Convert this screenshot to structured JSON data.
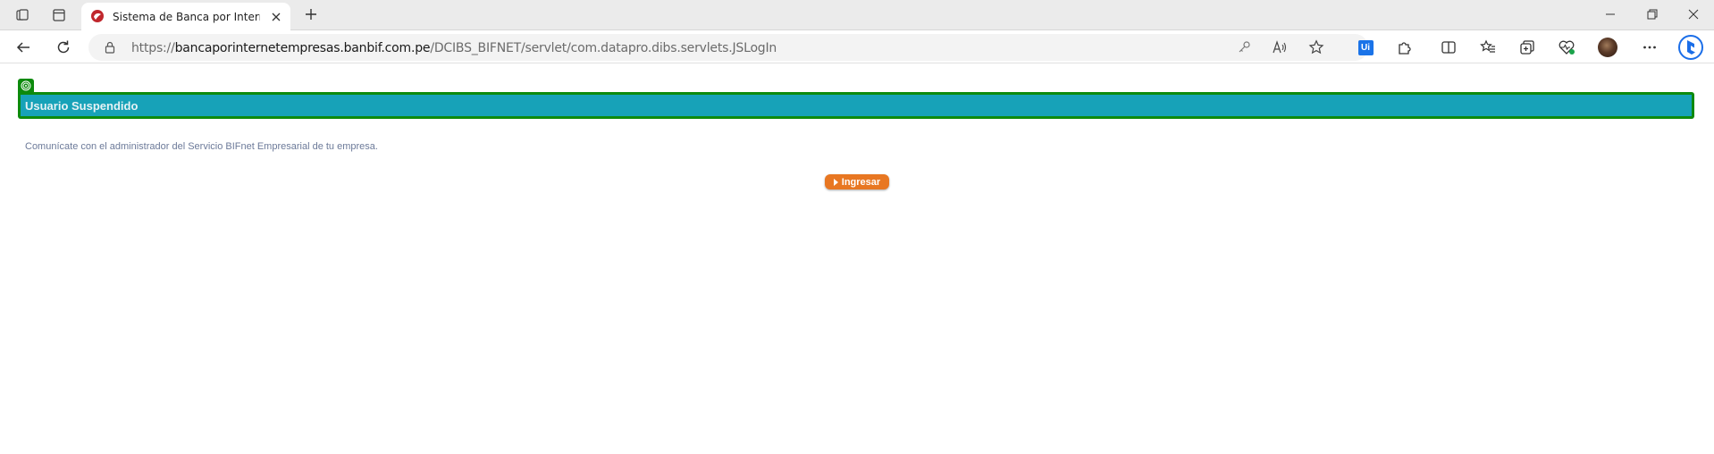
{
  "browser": {
    "tab": {
      "title": "Sistema de Banca por Internet: U"
    },
    "address": {
      "prefix": "https://",
      "host": "bancaporinternetempresas.banbif.com.pe",
      "path": "/DCIBS_BIFNET/servlet/com.datapro.dibs.servlets.JSLogIn"
    },
    "extension_label": "Ui",
    "accent": "#1a73e8"
  },
  "page": {
    "title": "Usuario Suspendido",
    "message": "Comunícate con el administrador del Servicio BIFnet Empresarial de tu empresa.",
    "button_label": "Ingresar",
    "colors": {
      "frame": "#0d8a0d",
      "title_bg": "#17a2b8",
      "button": "#e87722",
      "message_text": "#6c7a99"
    }
  }
}
